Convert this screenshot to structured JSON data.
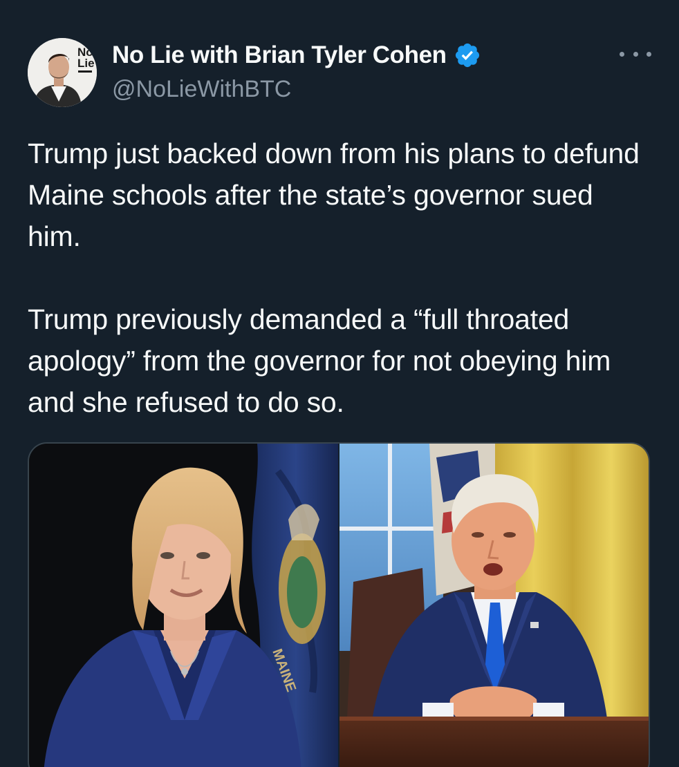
{
  "author": {
    "display_name": "No Lie with Brian Tyler Cohen",
    "handle": "@NoLieWithBTC",
    "verified": true,
    "avatar_badge_line1": "No",
    "avatar_badge_line2": "Lie"
  },
  "tweet": {
    "paragraphs": [
      "Trump just backed down from his plans to defund Maine schools after the state’s governor sued him.",
      "Trump previously demanded a “full throated apology” from the governor for not obeying him and she refused to do so."
    ]
  },
  "media": {
    "flag_text": "MAINE"
  },
  "colors": {
    "background": "#15202b",
    "text_primary": "#f7f9f9",
    "text_secondary": "#8b98a5",
    "verified_blue": "#1d9bf0",
    "border": "#38444d"
  },
  "icons": {
    "verified": "verified-badge-icon",
    "more": "more-options-icon"
  }
}
